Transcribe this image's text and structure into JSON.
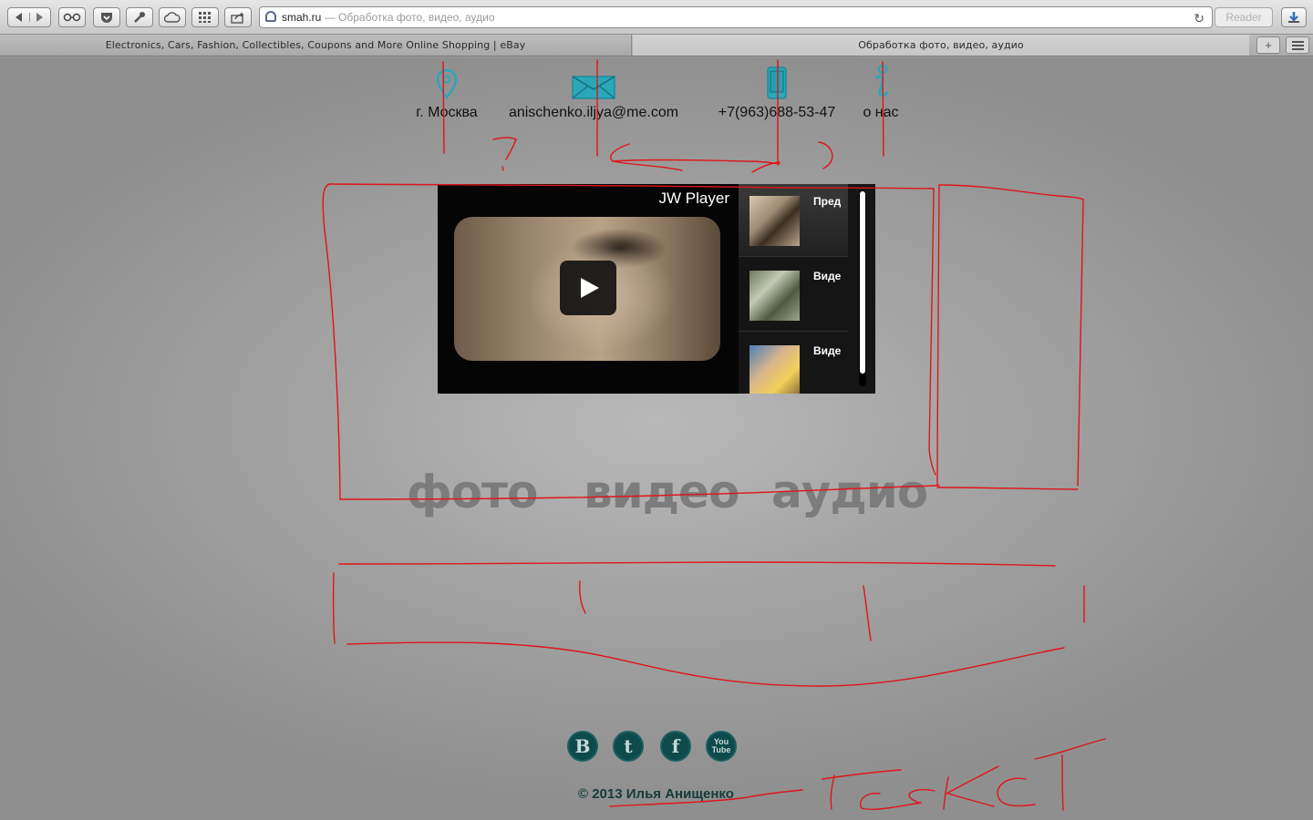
{
  "browser": {
    "url_host": "smah.ru",
    "url_sep": " — ",
    "page_title": "Обработка фото, видео, аудио",
    "reader_label": "Reader",
    "tabs": [
      {
        "label": "Electronics, Cars, Fashion, Collectibles, Coupons and More Online Shopping | eBay"
      },
      {
        "label": "Обработка фото, видео, аудио"
      }
    ],
    "new_tab_label": "+"
  },
  "contacts": {
    "city": "г. Москва",
    "email": "anischenko.iljya@me.com",
    "phone": "+7(963)688-53-47",
    "about": "о нас"
  },
  "player": {
    "title": "JW Player",
    "playlist": [
      {
        "label": "Пред"
      },
      {
        "label": "Виде"
      },
      {
        "label": "Виде"
      }
    ]
  },
  "nav": {
    "photo": "фото",
    "video": "видео",
    "audio": "аудио"
  },
  "social": {
    "vk": "B",
    "twitter": "t",
    "facebook": "f",
    "youtube_line1": "You",
    "youtube_line2": "Tube"
  },
  "footer": {
    "copyright": "© 2013 Илья Анищенко"
  },
  "annotation": {
    "handwritten_word": "текст"
  },
  "colors": {
    "icon_teal": "#2aa7b8",
    "annotation_red": "#e0141b",
    "social_bg": "#0f4a4a"
  }
}
